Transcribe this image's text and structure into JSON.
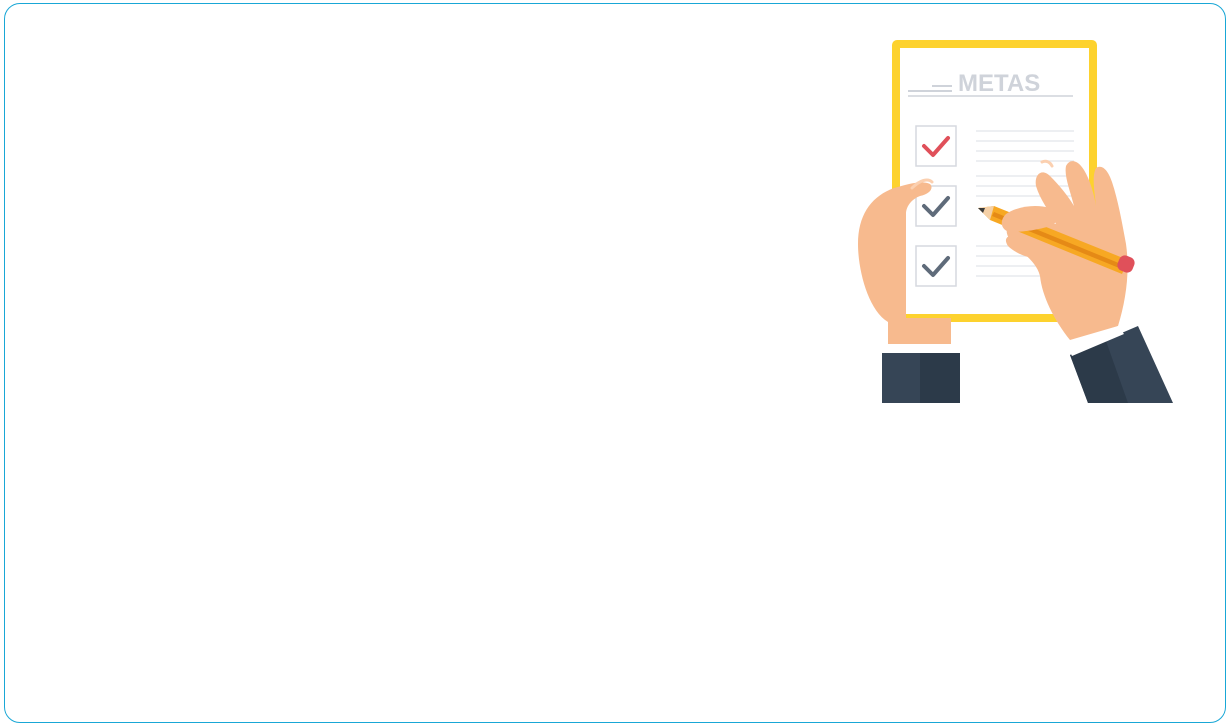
{
  "checklist": {
    "title": "METAS",
    "items": [
      {
        "checked": true,
        "check_color": "#e0505a"
      },
      {
        "checked": true,
        "check_color": "#5f6b7a"
      },
      {
        "checked": true,
        "check_color": "#5f6b7a"
      }
    ]
  },
  "colors": {
    "frame_border": "#19a7d6",
    "clipboard": "#fdd22e",
    "paper": "#ffffff",
    "skin": "#f7ba8e",
    "sleeve": "#364556",
    "pencil": "#f7a823",
    "eraser": "#e0505a"
  }
}
